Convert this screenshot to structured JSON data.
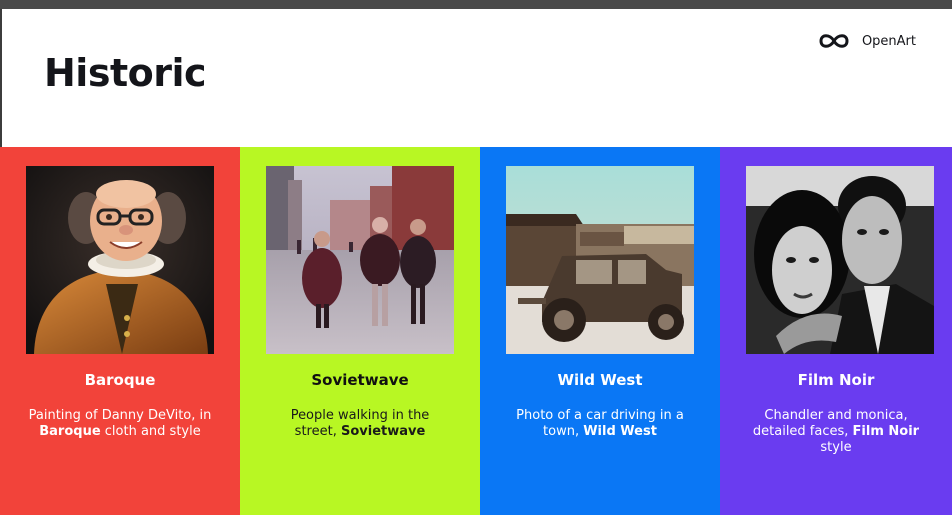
{
  "header": {
    "title": "Historic",
    "brand": {
      "icon": "infinity-logo-icon",
      "name": "OpenArt"
    }
  },
  "styles": [
    {
      "name": "Baroque",
      "color": "#f2433a",
      "image": "baroque-portrait-image",
      "desc_before": "Painting of Danny DeVito, in ",
      "desc_bold": "Baroque",
      "desc_after": " cloth and style"
    },
    {
      "name": "Sovietwave",
      "color": "#b8f723",
      "image": "soviet-street-photo-image",
      "desc_before": "People walking in the street, ",
      "desc_bold": "Sovietwave",
      "desc_after": ""
    },
    {
      "name": "Wild West",
      "color": "#0a77f5",
      "image": "old-car-town-photo-image",
      "desc_before": "Photo of a car driving in a town, ",
      "desc_bold": "Wild West",
      "desc_after": ""
    },
    {
      "name": "Film Noir",
      "color": "#6a3cf0",
      "image": "film-noir-couple-image",
      "desc_before": "Chandler and monica, detailed faces, ",
      "desc_bold": "Film Noir",
      "desc_after": " style"
    }
  ]
}
